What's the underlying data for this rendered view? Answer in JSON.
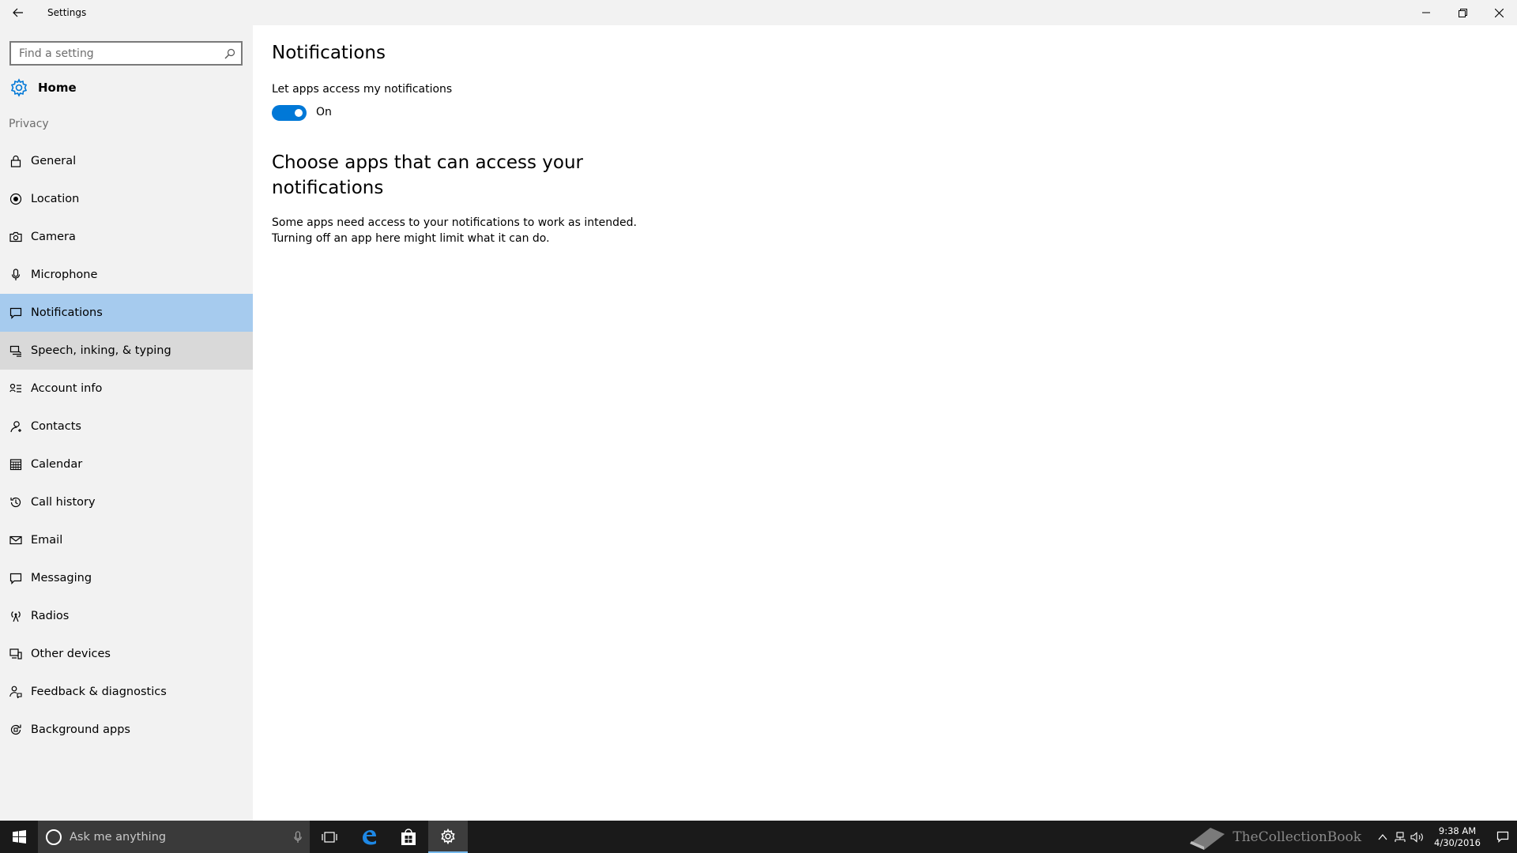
{
  "window": {
    "title": "Settings"
  },
  "sidebar": {
    "search_placeholder": "Find a setting",
    "home_label": "Home",
    "section_label": "Privacy",
    "items": [
      {
        "label": "General",
        "icon": "lock-icon"
      },
      {
        "label": "Location",
        "icon": "location-icon"
      },
      {
        "label": "Camera",
        "icon": "camera-icon"
      },
      {
        "label": "Microphone",
        "icon": "microphone-icon"
      },
      {
        "label": "Notifications",
        "icon": "notification-icon"
      },
      {
        "label": "Speech, inking, & typing",
        "icon": "speech-icon"
      },
      {
        "label": "Account info",
        "icon": "account-info-icon"
      },
      {
        "label": "Contacts",
        "icon": "contacts-icon"
      },
      {
        "label": "Calendar",
        "icon": "calendar-icon"
      },
      {
        "label": "Call history",
        "icon": "history-icon"
      },
      {
        "label": "Email",
        "icon": "email-icon"
      },
      {
        "label": "Messaging",
        "icon": "messaging-icon"
      },
      {
        "label": "Radios",
        "icon": "radios-icon"
      },
      {
        "label": "Other devices",
        "icon": "devices-icon"
      },
      {
        "label": "Feedback & diagnostics",
        "icon": "feedback-icon"
      },
      {
        "label": "Background apps",
        "icon": "background-apps-icon"
      }
    ],
    "selected": "Notifications",
    "hovered": "Speech, inking, & typing"
  },
  "main": {
    "title": "Notifications",
    "setting_label": "Let apps access my notifications",
    "toggle_state": "On",
    "section_title": "Choose apps that can access your notifications",
    "description_line1": "Some apps need access to your notifications to work as intended.",
    "description_line2": "Turning off an app here might limit what it can do."
  },
  "taskbar": {
    "search_placeholder": "Ask me anything",
    "time": "9:38 AM",
    "date": "4/30/2016",
    "watermark": "TheCollectionBook"
  },
  "colors": {
    "accent": "#0078d7",
    "selected_bg": "#a6cbee",
    "hover_bg": "#d9d9d9",
    "sidebar_bg": "#f2f2f2",
    "taskbar_bg": "#1a1a1a"
  }
}
